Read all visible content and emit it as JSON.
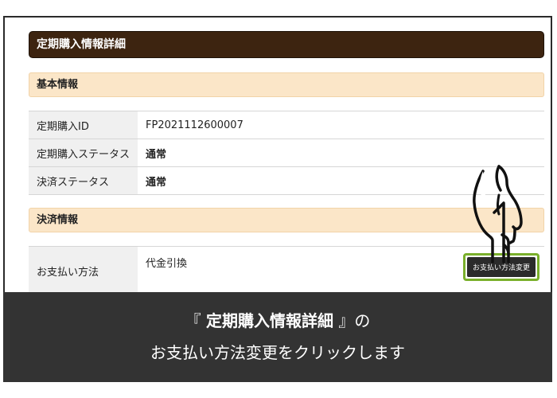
{
  "page": {
    "title": "定期購入情報詳細"
  },
  "basic_section": {
    "heading": "基本情報",
    "rows": [
      {
        "label": "定期購入ID",
        "value": "FP2021112600007"
      },
      {
        "label": "定期購入ステータス",
        "value": "通常"
      },
      {
        "label": "決済ステータス",
        "value": "通常"
      }
    ]
  },
  "payment_section": {
    "heading": "決済情報",
    "rows": [
      {
        "label": "お支払い方法",
        "value": "代金引換",
        "button_label": "お支払い方法変更"
      }
    ]
  },
  "instruction": {
    "bracket_open": "『",
    "page_name": "定期購入情報詳細",
    "bracket_close": "』の",
    "line2": "お支払い方法変更をクリックします"
  },
  "colors": {
    "title_bar": "#3d2410",
    "section_head": "#fbe6c8",
    "highlight": "#7ab02b",
    "overlay": "#333333"
  },
  "icons": [
    "pointing-hand-icon"
  ]
}
